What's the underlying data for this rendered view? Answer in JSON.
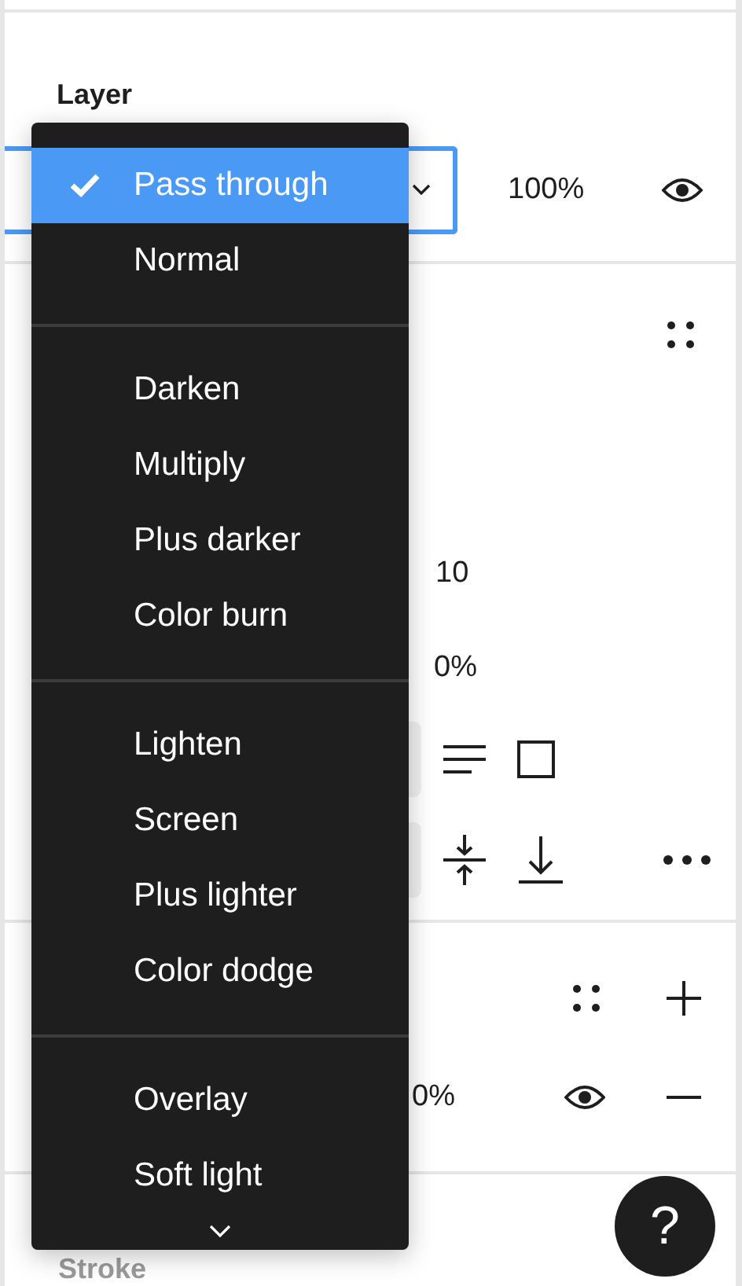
{
  "layer": {
    "title": "Layer",
    "opacity": "100%"
  },
  "effects": {
    "value_1": "10",
    "value_2": "0%"
  },
  "fill": {
    "opacity": "0%"
  },
  "stroke": {
    "title": "Stroke"
  },
  "help": {
    "label": "?"
  },
  "blend_menu": {
    "groups": [
      [
        {
          "label": "Pass through",
          "selected": true
        },
        {
          "label": "Normal",
          "selected": false
        }
      ],
      [
        {
          "label": "Darken",
          "selected": false
        },
        {
          "label": "Multiply",
          "selected": false
        },
        {
          "label": "Plus darker",
          "selected": false
        },
        {
          "label": "Color burn",
          "selected": false
        }
      ],
      [
        {
          "label": "Lighten",
          "selected": false
        },
        {
          "label": "Screen",
          "selected": false
        },
        {
          "label": "Plus lighter",
          "selected": false
        },
        {
          "label": "Color dodge",
          "selected": false
        }
      ],
      [
        {
          "label": "Overlay",
          "selected": false
        },
        {
          "label": "Soft light",
          "selected": false
        }
      ]
    ]
  }
}
